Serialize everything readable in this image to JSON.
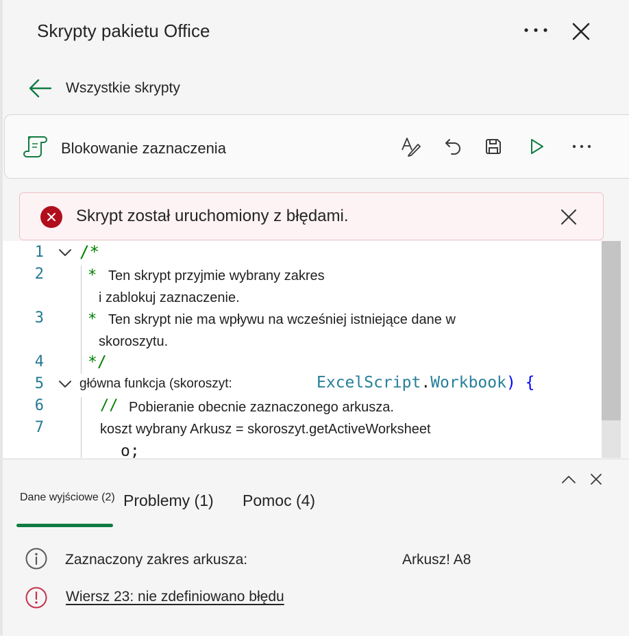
{
  "header": {
    "title": "Skrypty pakietu Office"
  },
  "nav": {
    "back_label": "Wszystkie skrypty"
  },
  "script": {
    "name": "Blokowanie zaznaczenia"
  },
  "banner": {
    "message": "Skrypt został uruchomiony z błędami."
  },
  "editor": {
    "line_numbers": [
      "1",
      "2",
      "3",
      "4",
      "5",
      "6",
      "7"
    ],
    "lines": {
      "l1": "/*",
      "l2_mark": "*",
      "l2_text": "Ten skrypt przyjmie wybrany zakres",
      "l2_wrap": "i zablokuj zaznaczenie.",
      "l3_mark": "*",
      "l3_text": "Ten skrypt nie ma wpływu na wcześniej istniejące dane w",
      "l3_wrap": "skoroszytu.",
      "l4": "*/",
      "l5_text": "główna funkcja (skoroszyt:",
      "l5_type1": "ExcelScript",
      "l5_dot": ".",
      "l5_type2": "Workbook",
      "l5_tail": ") {",
      "l6_mark": "//",
      "l6_text": "Pobieranie obecnie zaznaczonego arkusza.",
      "l7_text": "koszt wybrany Arkusz = skoroszyt.getActiveWorksheet",
      "l7_wrap": "o;"
    }
  },
  "output_panel": {
    "tabs": [
      {
        "label": "Dane wyjściowe (2)",
        "active": true
      },
      {
        "label": "Problemy (1)",
        "active": false
      },
      {
        "label": "Pomoc (4)",
        "active": false
      }
    ],
    "rows": [
      {
        "icon": "info-icon",
        "text": "Zaznaczony zakres arkusza:",
        "value": "Arkusz! A8"
      },
      {
        "icon": "error-icon",
        "text": "Wiersz 23: nie zdefiniowano błędu"
      }
    ]
  },
  "colors": {
    "accent": "#107c41",
    "error": "#b10e1c",
    "line_number": "#237893",
    "comment": "#008000",
    "type": "#267f99",
    "keyword": "#0000ff"
  }
}
